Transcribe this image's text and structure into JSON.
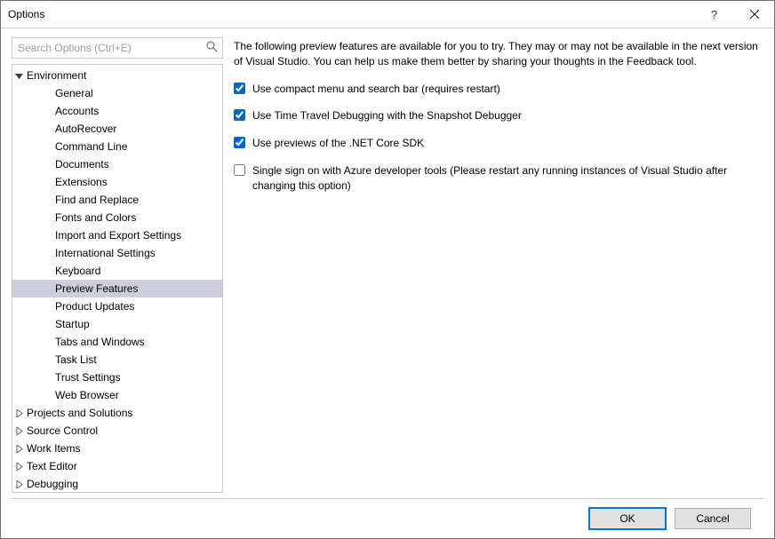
{
  "window": {
    "title": "Options"
  },
  "search": {
    "placeholder": "Search Options (Ctrl+E)"
  },
  "tree": {
    "rows": [
      {
        "label": "Environment",
        "indent": 0,
        "chevron": "down",
        "selected": false
      },
      {
        "label": "General",
        "indent": 1,
        "chevron": "",
        "selected": false
      },
      {
        "label": "Accounts",
        "indent": 1,
        "chevron": "",
        "selected": false
      },
      {
        "label": "AutoRecover",
        "indent": 1,
        "chevron": "",
        "selected": false
      },
      {
        "label": "Command Line",
        "indent": 1,
        "chevron": "",
        "selected": false
      },
      {
        "label": "Documents",
        "indent": 1,
        "chevron": "",
        "selected": false
      },
      {
        "label": "Extensions",
        "indent": 1,
        "chevron": "",
        "selected": false
      },
      {
        "label": "Find and Replace",
        "indent": 1,
        "chevron": "",
        "selected": false
      },
      {
        "label": "Fonts and Colors",
        "indent": 1,
        "chevron": "",
        "selected": false
      },
      {
        "label": "Import and Export Settings",
        "indent": 1,
        "chevron": "",
        "selected": false
      },
      {
        "label": "International Settings",
        "indent": 1,
        "chevron": "",
        "selected": false
      },
      {
        "label": "Keyboard",
        "indent": 1,
        "chevron": "",
        "selected": false
      },
      {
        "label": "Preview Features",
        "indent": 1,
        "chevron": "",
        "selected": true
      },
      {
        "label": "Product Updates",
        "indent": 1,
        "chevron": "",
        "selected": false
      },
      {
        "label": "Startup",
        "indent": 1,
        "chevron": "",
        "selected": false
      },
      {
        "label": "Tabs and Windows",
        "indent": 1,
        "chevron": "",
        "selected": false
      },
      {
        "label": "Task List",
        "indent": 1,
        "chevron": "",
        "selected": false
      },
      {
        "label": "Trust Settings",
        "indent": 1,
        "chevron": "",
        "selected": false
      },
      {
        "label": "Web Browser",
        "indent": 1,
        "chevron": "",
        "selected": false
      },
      {
        "label": "Projects and Solutions",
        "indent": 0,
        "chevron": "right",
        "selected": false
      },
      {
        "label": "Source Control",
        "indent": 0,
        "chevron": "right",
        "selected": false
      },
      {
        "label": "Work Items",
        "indent": 0,
        "chevron": "right",
        "selected": false
      },
      {
        "label": "Text Editor",
        "indent": 0,
        "chevron": "right",
        "selected": false
      },
      {
        "label": "Debugging",
        "indent": 0,
        "chevron": "right",
        "selected": false
      }
    ]
  },
  "content": {
    "intro": "The following preview features are available for you to try. They may or may not be available in the next version of Visual Studio. You can help us make them better by sharing your thoughts in the Feedback tool.",
    "options": [
      {
        "label": "Use compact menu and search bar (requires restart)",
        "checked": true
      },
      {
        "label": "Use Time Travel Debugging with the Snapshot Debugger",
        "checked": true
      },
      {
        "label": "Use previews of the .NET Core SDK",
        "checked": true
      },
      {
        "label": "Single sign on with Azure developer tools (Please restart any running instances of Visual Studio after changing this option)",
        "checked": false
      }
    ]
  },
  "buttons": {
    "ok": "OK",
    "cancel": "Cancel"
  }
}
